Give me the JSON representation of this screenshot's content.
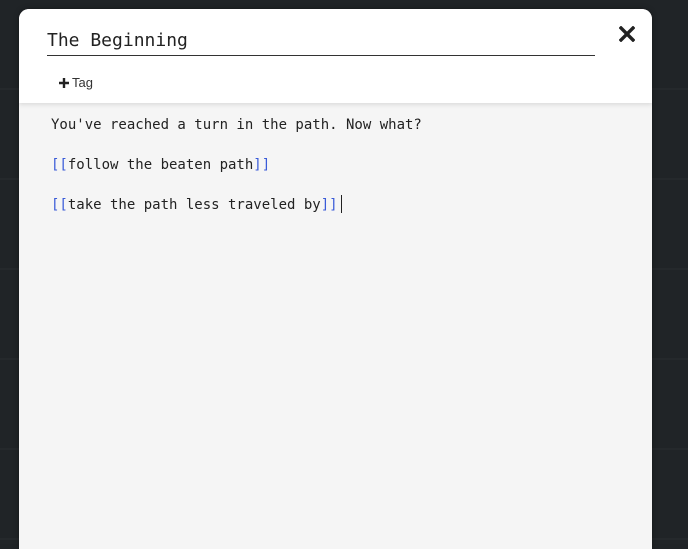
{
  "passage": {
    "title": "The Beginning",
    "tag_label": "Tag",
    "body": {
      "line1": "You've reached a turn in the path. Now what?",
      "link1": {
        "open": "[[",
        "text": "follow the beaten path",
        "close": "]]"
      },
      "link2": {
        "open": "[[",
        "text": "take the path less traveled by",
        "close": "]]"
      }
    }
  },
  "icons": {
    "close": "close-icon",
    "plus": "plus-icon"
  },
  "colors": {
    "link_bracket": "#3a5bd8",
    "background": "#1f2326",
    "editor_bg": "#f5f5f5"
  }
}
